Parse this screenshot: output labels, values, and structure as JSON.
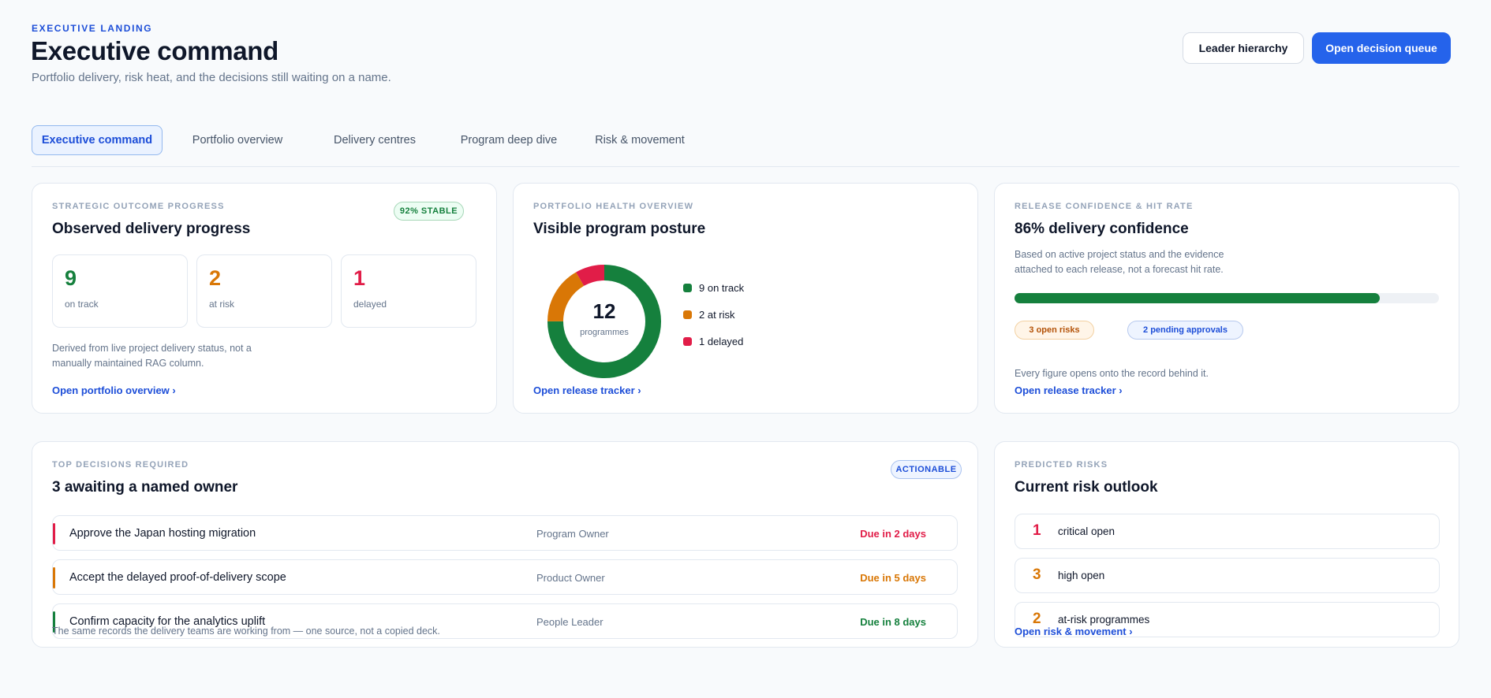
{
  "header": {
    "eyebrow": "EXECUTIVE LANDING",
    "title": "Executive command",
    "subtitle": "Portfolio delivery, risk heat, and the decisions still waiting on a name.",
    "buttons": {
      "leader_hierarchy": "Leader hierarchy",
      "open_decision_queue": "Open decision queue"
    }
  },
  "tabs": [
    {
      "label": "Executive command",
      "active": true
    },
    {
      "label": "Portfolio overview",
      "active": false
    },
    {
      "label": "Delivery centres",
      "active": false
    },
    {
      "label": "Program deep dive",
      "active": false
    },
    {
      "label": "Risk & movement",
      "active": false
    }
  ],
  "strategic": {
    "eyebrow": "STRATEGIC OUTCOME PROGRESS",
    "title": "Observed delivery progress",
    "badge": "92% STABLE",
    "stats": [
      {
        "value": "9",
        "label": "on track",
        "color": "#15803d"
      },
      {
        "value": "2",
        "label": "at risk",
        "color": "#d97706"
      },
      {
        "value": "1",
        "label": "delayed",
        "color": "#e11d48"
      }
    ],
    "note_line1": "Derived from live project delivery status, not a",
    "note_line2": "manually maintained RAG column.",
    "link": "Open portfolio overview ›"
  },
  "health": {
    "eyebrow": "PORTFOLIO HEALTH OVERVIEW",
    "title": "Visible program posture",
    "donut_total": "12",
    "donut_caption": "programmes",
    "segments": [
      {
        "label": "9 on track",
        "value": 9,
        "color": "#15803d"
      },
      {
        "label": "2 at risk",
        "value": 2,
        "color": "#d97706"
      },
      {
        "label": "1 delayed",
        "value": 1,
        "color": "#e11d48"
      }
    ],
    "link": "Open release tracker ›"
  },
  "release": {
    "eyebrow": "RELEASE CONFIDENCE & HIT RATE",
    "title": "86% delivery confidence",
    "note_line1": "Based on active project status and the evidence",
    "note_line2": "attached to each release, not a forecast hit rate.",
    "progress": 0.86,
    "chips": {
      "risks": "3 open risks",
      "approvals": "2 pending approvals"
    },
    "footer": "Every figure opens onto the record behind it.",
    "link": "Open release tracker ›"
  },
  "decisions": {
    "eyebrow": "TOP DECISIONS REQUIRED",
    "title": "3 awaiting a named owner",
    "badge": "ACTIONABLE",
    "items": [
      {
        "title": "Approve the Japan hosting migration",
        "owner": "Program Owner",
        "due": "Due in 2 days",
        "color": "#e11d48"
      },
      {
        "title": "Accept the delayed proof-of-delivery scope",
        "owner": "Product Owner",
        "due": "Due in 5 days",
        "color": "#d97706"
      },
      {
        "title": "Confirm capacity for the analytics uplift",
        "owner": "People Leader",
        "due": "Due in 8 days",
        "color": "#15803d"
      }
    ],
    "footer": "The same records the delivery teams are working from — one source, not a copied deck."
  },
  "risks": {
    "eyebrow": "PREDICTED RISKS",
    "title": "Current risk outlook",
    "items": [
      {
        "value": "1",
        "label": "critical open",
        "color": "#e11d48"
      },
      {
        "value": "3",
        "label": "high open",
        "color": "#d97706"
      },
      {
        "value": "2",
        "label": "at-risk programmes",
        "color": "#d97706"
      }
    ],
    "link": "Open risk & movement ›"
  }
}
